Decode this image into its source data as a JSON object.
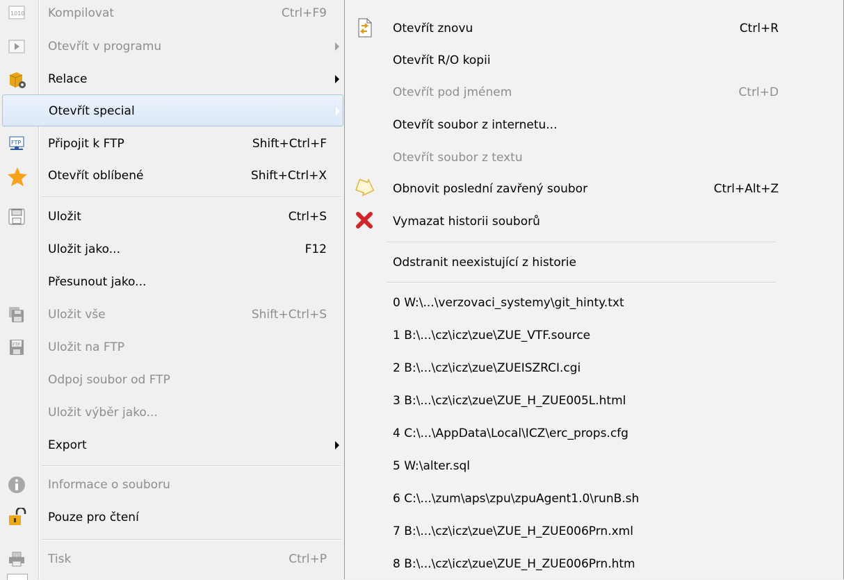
{
  "main_menu": {
    "items": [
      {
        "label": "Kompilovat",
        "shortcut": "Ctrl+F9",
        "icon": "binary-icon",
        "disabled": true
      },
      {
        "label": "Otevřít v programu",
        "shortcut": "",
        "icon": "play-box-icon",
        "disabled": true,
        "submenu": true
      },
      {
        "label": "Relace",
        "shortcut": "",
        "icon": "session-gear-icon",
        "disabled": false,
        "submenu": true
      },
      {
        "label": "Otevřít special",
        "shortcut": "",
        "icon": "",
        "disabled": false,
        "submenu": true,
        "highlighted": true
      },
      {
        "label": "Připojit k FTP",
        "shortcut": "Shift+Ctrl+F",
        "icon": "ftp-connect-icon",
        "disabled": false
      },
      {
        "label": "Otevřít oblíbené",
        "shortcut": "Shift+Ctrl+X",
        "icon": "star-icon",
        "disabled": false
      },
      {
        "label": "Uložit",
        "shortcut": "Ctrl+S",
        "icon": "floppy-icon",
        "disabled": false
      },
      {
        "label": "Uložit jako...",
        "shortcut": "F12",
        "icon": "",
        "disabled": false
      },
      {
        "label": "Přesunout jako...",
        "shortcut": "",
        "icon": "",
        "disabled": false
      },
      {
        "label": "Uložit vše",
        "shortcut": "Shift+Ctrl+S",
        "icon": "save-all-icon",
        "disabled": true
      },
      {
        "label": "Uložit na FTP",
        "shortcut": "",
        "icon": "ftp-save-icon",
        "disabled": true
      },
      {
        "label": "Odpoj soubor od FTP",
        "shortcut": "",
        "icon": "",
        "disabled": true
      },
      {
        "label": "Uložit výběr jako...",
        "shortcut": "",
        "icon": "",
        "disabled": true
      },
      {
        "label": "Export",
        "shortcut": "",
        "icon": "",
        "disabled": false,
        "submenu": true
      },
      {
        "label": "Informace o souboru",
        "shortcut": "",
        "icon": "info-icon",
        "disabled": true
      },
      {
        "label": "Pouze pro čtení",
        "shortcut": "",
        "icon": "padlock-icon",
        "disabled": false
      },
      {
        "label": "Tisk",
        "shortcut": "Ctrl+P",
        "icon": "printer-icon",
        "disabled": true
      }
    ]
  },
  "sub_menu": {
    "items": [
      {
        "label": "Otevřít znovu",
        "shortcut": "Ctrl+R",
        "icon": "reopen-document-icon",
        "disabled": false
      },
      {
        "label": "Otevřít R/O kopii",
        "shortcut": "",
        "icon": "",
        "disabled": false
      },
      {
        "label": "Otevřít pod jménem",
        "shortcut": "Ctrl+D",
        "icon": "",
        "disabled": true
      },
      {
        "label": "Otevřít soubor z internetu...",
        "shortcut": "",
        "icon": "",
        "disabled": false
      },
      {
        "label": "Otevřít soubor z textu",
        "shortcut": "",
        "icon": "",
        "disabled": true
      },
      {
        "label": "Obnovit poslední zavřený soubor",
        "shortcut": "Ctrl+Alt+Z",
        "icon": "restore-arrow-icon",
        "disabled": false
      },
      {
        "label": "Vymazat historii souborů",
        "shortcut": "",
        "icon": "red-x-icon",
        "disabled": false
      },
      {
        "label": "Odstranit neexistující z historie",
        "shortcut": "",
        "icon": "",
        "disabled": false
      }
    ],
    "history": [
      "0 W:\\...\\verzovaci_systemy\\git_hinty.txt",
      "1 B:\\...\\cz\\icz\\zue\\ZUE_VTF.source",
      "2 B:\\...\\cz\\icz\\zue\\ZUEISZRCI.cgi",
      "3 B:\\...\\cz\\icz\\zue\\ZUE_H_ZUE005L.html",
      "4 C:\\...\\AppData\\Local\\ICZ\\erc_props.cfg",
      "5 W:\\alter.sql",
      "6 C:\\...\\zum\\aps\\zpu\\zpuAgent1.0\\runB.sh",
      "7 B:\\...\\cz\\icz\\zue\\ZUE_H_ZUE006Prn.xml",
      "8 B:\\...\\cz\\icz\\zue\\ZUE_H_ZUE006Prn.htm"
    ]
  },
  "colors": {
    "menu_bg": "#f0f0f0",
    "disabled_text": "#8e8e8e",
    "highlight_border": "#a7c4e8",
    "star": "#f7a21b",
    "red_x": "#d0262b"
  }
}
